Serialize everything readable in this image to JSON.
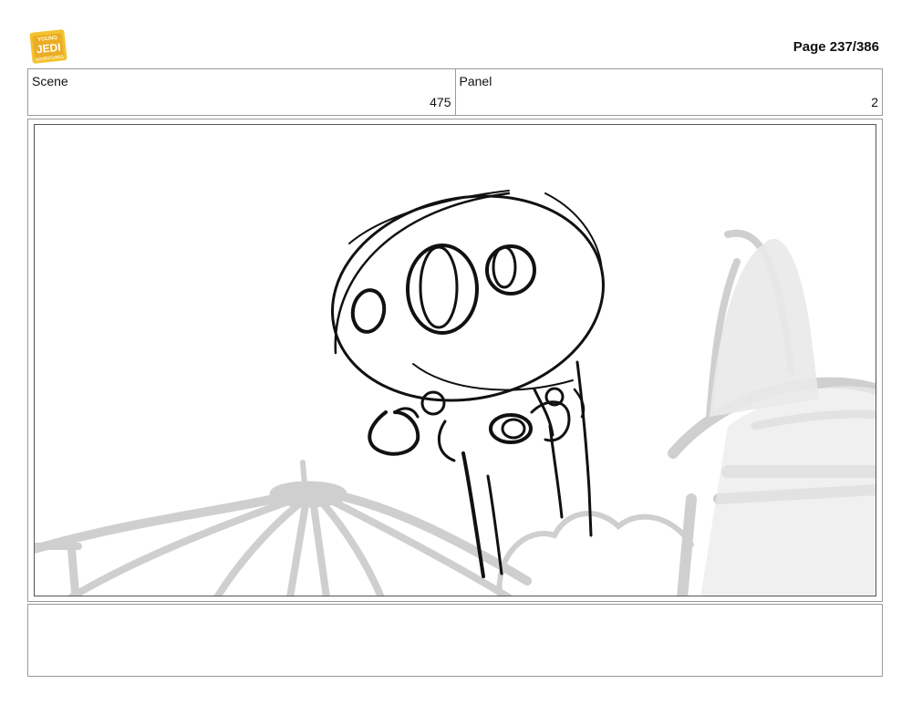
{
  "header": {
    "page_label": "Page 237/386",
    "logo_text": [
      "YOUNG",
      "JEDI",
      "ADVENTURES"
    ]
  },
  "meta": {
    "scene_label": "Scene",
    "scene_value": "475",
    "panel_label": "Panel",
    "panel_value": "2"
  },
  "panel": {
    "image_icon": "storyboard-sketch"
  },
  "notes": {
    "text": ""
  },
  "colors": {
    "logo_yellow": "#f2c230",
    "logo_orange": "#e79a1c",
    "border": "#9a9a9a",
    "sketch_ink": "#111111",
    "background_sketch": "#c9c9c9"
  }
}
